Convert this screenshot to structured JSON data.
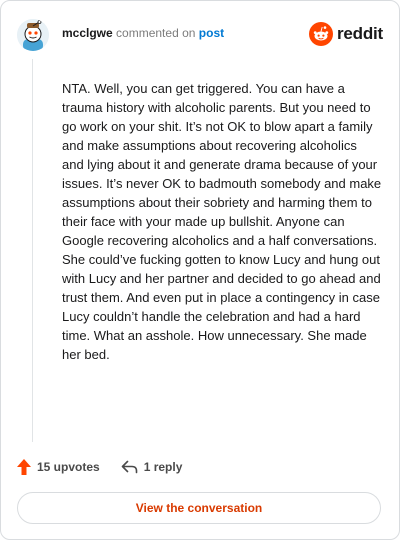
{
  "comment": {
    "author": "mcclgwe",
    "action_text": "commented on",
    "target_text": "post",
    "body": "NTA. Well, you can get triggered. You can have a trauma history with alcoholic parents. But you need to go work on your shit. It’s not OK to blow apart a family and make assumptions about recovering alcoholics and lying about it and generate drama because of your issues. It’s never OK to badmouth somebody and make assumptions about their sobriety and harming them to their face with your made up bullshit. Anyone can Google recovering alcoholics and a half conversations. She could’ve fucking gotten to know Lucy and hung out with Lucy and her partner and decided to go ahead and trust them. And even put in place a contingency in case Lucy couldn’t handle the celebration and had a hard time. What an asshole. How unnecessary. She made her bed.",
    "upvotes_label": "15 upvotes",
    "replies_label": "1 reply"
  },
  "brand": {
    "name": "reddit",
    "color": "#ff4500"
  },
  "icons": {
    "avatar": "snoo-avatar",
    "logo": "reddit-logo-icon",
    "upvote": "upvote-arrow-icon",
    "reply": "reply-arrow-icon"
  },
  "cta": {
    "label": "View the conversation",
    "color": "#d93a00"
  }
}
